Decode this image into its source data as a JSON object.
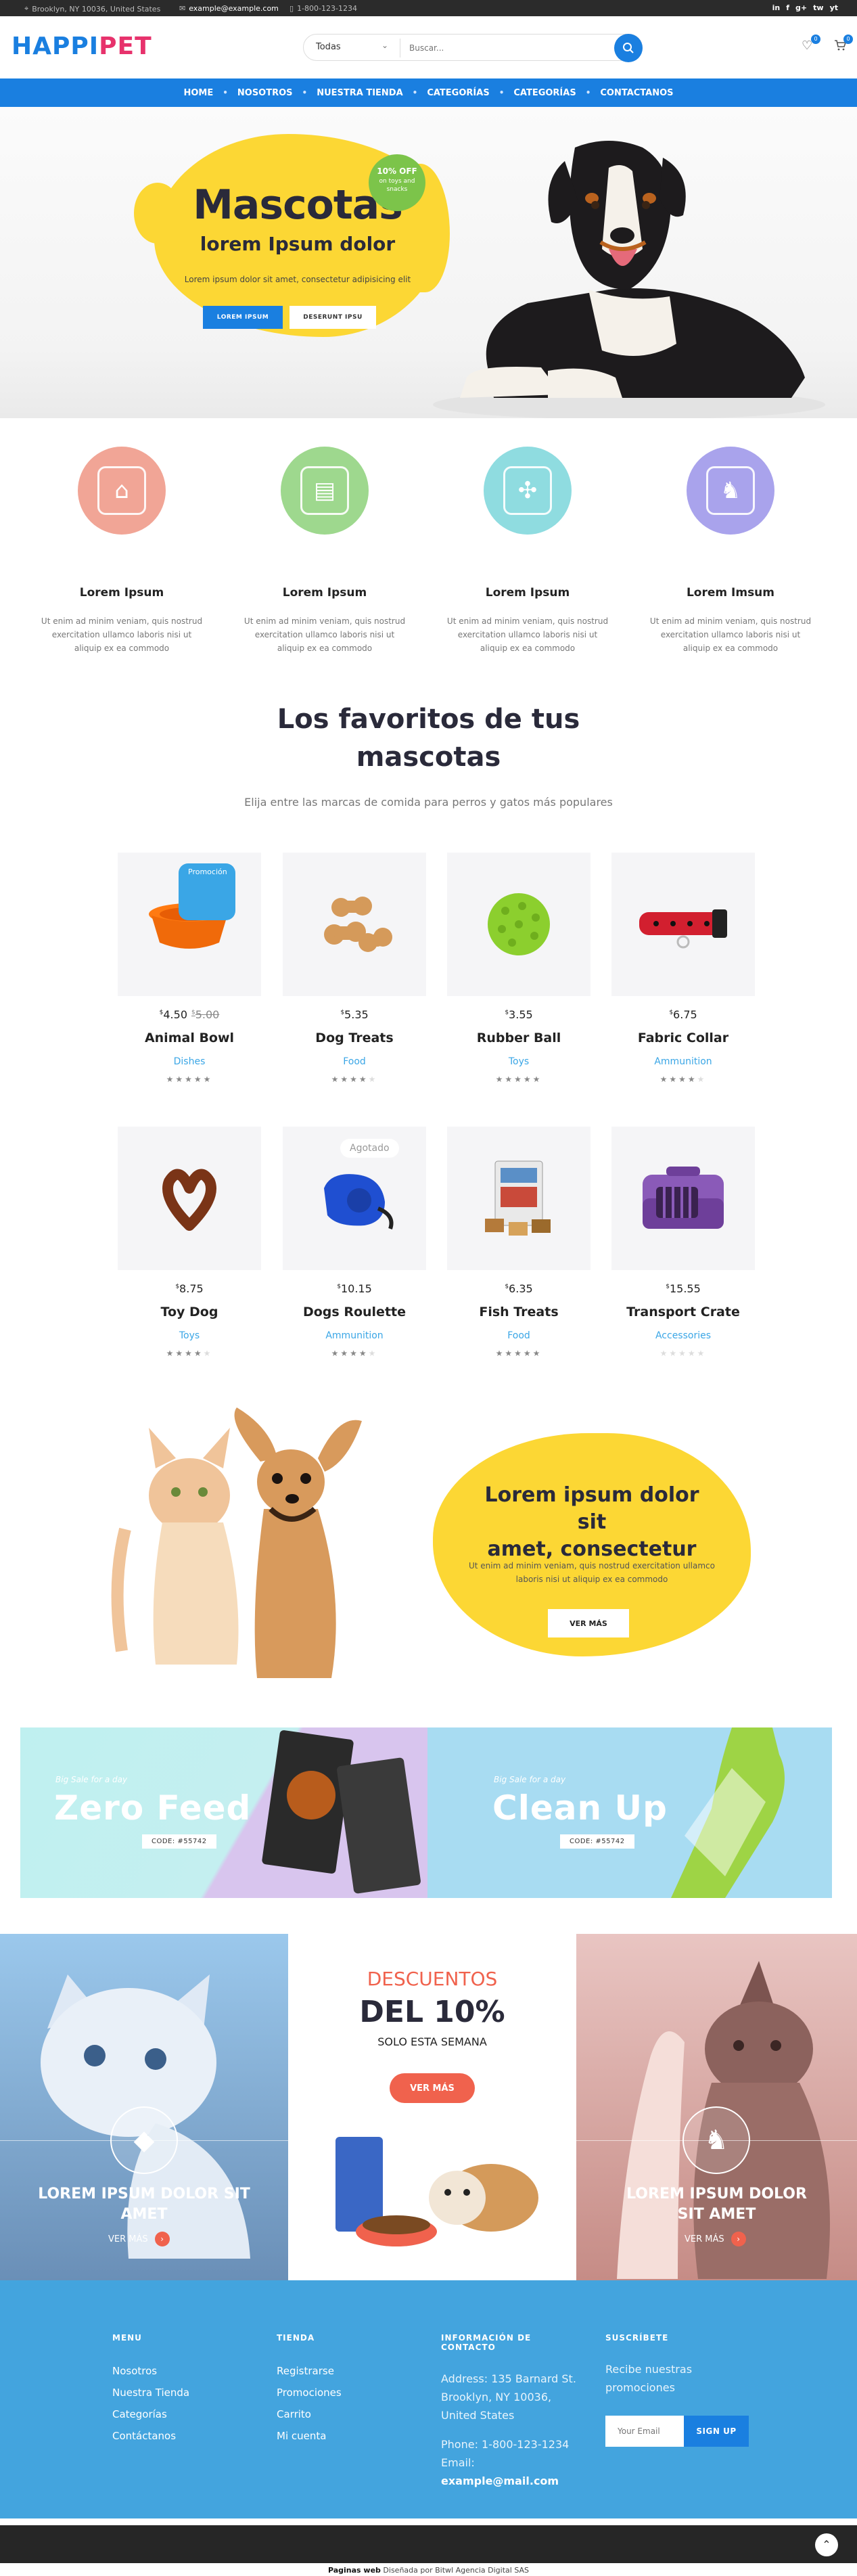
{
  "topbar": {
    "address": "Brooklyn, NY 10036, United States",
    "email": "example@example.com",
    "phone": "1-800-123-1234",
    "social": [
      "in",
      "f",
      "g+",
      "tw",
      "yt"
    ]
  },
  "header": {
    "logo_part1": "HAPPI",
    "logo_part2": "PET",
    "search_category": "Todas",
    "search_placeholder": "Buscar...",
    "wishlist_count": "0",
    "cart_count": "0"
  },
  "nav": {
    "items": [
      "HOME",
      "NOSOTROS",
      "NUESTRA TIENDA",
      "CATEGORÍAS",
      "CATEGORÍAS",
      "CONTACTANOS"
    ]
  },
  "hero": {
    "title": "Mascotas",
    "subtitle": "lorem Ipsum dolor",
    "text": "Lorem ipsum dolor sit amet, consectetur adipisicing elit",
    "btn1": "LOREM IPSUM",
    "btn2": "DESERUNT IPSU",
    "promo_pct": "10% OFF",
    "promo_text": "on toys and snacks"
  },
  "features": [
    {
      "title": "Lorem Ipsum",
      "text": "Ut enim ad minim veniam, quis nostrud exercitation ullamco laboris nisi ut aliquip ex ea commodo",
      "color": "#f1a596",
      "icon": "store-icon"
    },
    {
      "title": "Lorem Ipsum",
      "text": "Ut enim ad minim veniam, quis nostrud exercitation ullamco laboris nisi ut aliquip ex ea commodo",
      "color": "#9ed88e",
      "icon": "document-icon"
    },
    {
      "title": "Lorem Ipsum",
      "text": "Ut enim ad minim veniam, quis nostrud exercitation ullamco laboris nisi ut aliquip ex ea commodo",
      "color": "#8fdce0",
      "icon": "bone-icon"
    },
    {
      "title": "Lorem Imsum",
      "text": "Ut enim ad minim veniam, quis nostrud exercitation ullamco laboris nisi ut aliquip ex ea commodo",
      "color": "#a9a3ec",
      "icon": "dog-walk-icon"
    }
  ],
  "favorites": {
    "title_line1": "Los favoritos de tus",
    "title_line2": "mascotas",
    "subtitle": "Elija entre las marcas de comida para perros y gatos más populares"
  },
  "products": [
    {
      "name": "Animal Bowl",
      "price": "4.50",
      "old_price": "5.00",
      "category": "Dishes",
      "rating": 5,
      "tag": "Promoción",
      "tag_type": "promo",
      "icon": "bowl-icon"
    },
    {
      "name": "Dog Treats",
      "price": "5.35",
      "old_price": "",
      "category": "Food",
      "rating": 4,
      "tag": "",
      "tag_type": "",
      "icon": "treats-icon"
    },
    {
      "name": "Rubber Ball",
      "price": "3.55",
      "old_price": "",
      "category": "Toys",
      "rating": 5,
      "tag": "",
      "tag_type": "",
      "icon": "ball-icon"
    },
    {
      "name": "Fabric Collar",
      "price": "6.75",
      "old_price": "",
      "category": "Ammunition",
      "rating": 4,
      "tag": "",
      "tag_type": "",
      "icon": "collar-icon"
    },
    {
      "name": "Toy Dog",
      "price": "8.75",
      "old_price": "",
      "category": "Toys",
      "rating": 4,
      "tag": "",
      "tag_type": "",
      "icon": "pretzel-icon"
    },
    {
      "name": "Dogs Roulette",
      "price": "10.15",
      "old_price": "",
      "category": "Ammunition",
      "rating": 4,
      "tag": "Agotado",
      "tag_type": "out",
      "icon": "leash-icon"
    },
    {
      "name": "Fish Treats",
      "price": "6.35",
      "old_price": "",
      "category": "Food",
      "rating": 5,
      "tag": "",
      "tag_type": "",
      "icon": "fish-treats-icon"
    },
    {
      "name": "Transport Crate",
      "price": "15.55",
      "old_price": "",
      "category": "Accessories",
      "rating": 0,
      "tag": "",
      "tag_type": "",
      "icon": "crate-icon"
    }
  ],
  "pets_section": {
    "title_line1": "Lorem ipsum dolor sit",
    "title_line2": "amet, consectetur",
    "text": "Ut enim ad minim veniam, quis nostrud exercitation ullamco laboris nisi ut aliquip ex ea commodo",
    "button": "VER MÁS"
  },
  "banners": [
    {
      "label": "Big Sale for a day",
      "title": "Zero Feed",
      "code": "CODE: #55742"
    },
    {
      "label": "Big Sale for a day",
      "title": "Clean Up",
      "code": "CODE: #55742"
    }
  ],
  "trio": {
    "left": {
      "title_line1": "LOREM IPSUM DOLOR SIT",
      "title_line2": "AMET",
      "more": "VER MÁS"
    },
    "center": {
      "line1": "DESCUENTOS",
      "line2": "DEL 10%",
      "line3": "SOLO ESTA SEMANA",
      "button": "VER MÁS"
    },
    "right": {
      "title_line1": "LOREM IPSUM DOLOR",
      "title_line2": "SIT AMET",
      "more": "VER MÁS"
    }
  },
  "footer": {
    "menu_title": "MENU",
    "menu": [
      "Nosotros",
      "Nuestra Tienda",
      "Categorías",
      "Contáctanos"
    ],
    "store_title": "TIENDA",
    "store": [
      "Registrarse",
      "Promociones",
      "Carrito",
      "Mi cuenta"
    ],
    "contact_title": "INFORMACIÓN DE CONTACTO",
    "contact_address": "Address: 135 Barnard St. Brooklyn, NY 10036, United States",
    "contact_phone": "Phone: 1-800-123-1234",
    "contact_email_label": "Email: ",
    "contact_email": "example@mail.com",
    "subscribe_title": "SUSCRÍBETE",
    "subscribe_text": "Recibe nuestras promociones",
    "email_placeholder": "Your Email",
    "signup": "SIGN UP"
  },
  "credit": {
    "bold": "Paginas web",
    "text": " Diseñada por Bitwl Agencia Digital SAS"
  },
  "colors": {
    "primary": "#1a7fe0",
    "accent": "#e7326c",
    "yellow": "#fcd734",
    "footer": "#43a4de",
    "orange": "#f0624d"
  }
}
